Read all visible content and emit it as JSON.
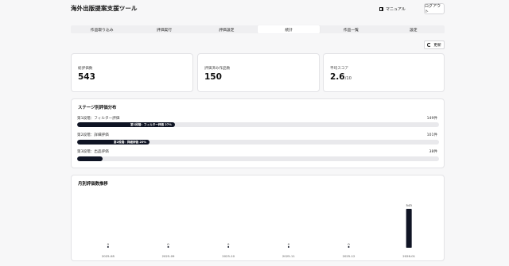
{
  "header": {
    "title": "海外出版提案支援ツール",
    "manual_label": "マニュアル",
    "manual_icon": "book-icon",
    "logout_label": "ログアウト"
  },
  "tabs": [
    {
      "label": "作品取り込み",
      "active": false
    },
    {
      "label": "評価実行",
      "active": false
    },
    {
      "label": "評価設定",
      "active": false
    },
    {
      "label": "統計",
      "active": true
    },
    {
      "label": "作品一覧",
      "active": false
    },
    {
      "label": "設定",
      "active": false
    }
  ],
  "refresh": {
    "label": "更新",
    "icon": "refresh-icon"
  },
  "stats": [
    {
      "label": "総評価数",
      "value": "543",
      "unit": ""
    },
    {
      "label": "評価済み作品数",
      "value": "150",
      "unit": ""
    },
    {
      "label": "平均スコア",
      "value": "2.6",
      "unit": "/10"
    }
  ],
  "stage_distribution": {
    "title": "ステージ別評価分布",
    "stages": [
      {
        "label": "第1段階：フィルター評価",
        "count": "149件",
        "percent": 27,
        "bar_label": "第1段階：フィルター評価 27%"
      },
      {
        "label": "第2段階：詳細評価",
        "count": "101件",
        "percent": 20,
        "bar_label": "第2段階：詳細評価 20%"
      },
      {
        "label": "第3段階：出品評価",
        "count": "38件",
        "percent": 7,
        "bar_label": ""
      }
    ]
  },
  "monthly": {
    "title": "月別評価数推移"
  },
  "chart_data": {
    "type": "bar",
    "title": "月別評価数推移",
    "categories": [
      "2025-08",
      "2025-09",
      "2025-10",
      "2025-11",
      "2025-12",
      "2026-01"
    ],
    "values": [
      0,
      0,
      0,
      0,
      0,
      543
    ],
    "ylim": [
      0,
      543
    ],
    "grid": false,
    "color": "#0f1424"
  },
  "colors": {
    "accent": "#0f1424",
    "track": "#e9e9ec",
    "page_bg": "#f7f7f8"
  }
}
